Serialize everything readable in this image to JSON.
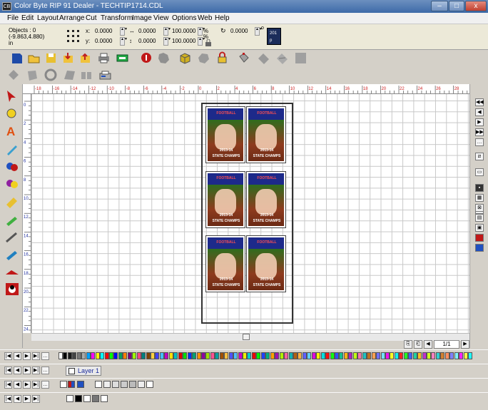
{
  "app": {
    "title": "Color Byte RIP 91 Dealer - TECHTIP1714.CDL",
    "icon_label": "CB"
  },
  "window_controls": {
    "minimize": "–",
    "maximize": "□",
    "close": "x"
  },
  "menu": [
    "File",
    "Edit",
    "Layout",
    "Arrange",
    "Cut",
    "Transform",
    "Image",
    "View",
    "Options",
    "Web",
    "Help"
  ],
  "props": {
    "objects_label": "Objects : 0",
    "coords_readout": "(-9.863,4.880)",
    "units": "in",
    "x_label": "x:",
    "y_label": "y:",
    "x_value": "0.0000",
    "y_value": "0.0000",
    "w_value": "0.0000",
    "h_value": "0.0000",
    "sx_value": "100.0000",
    "sy_value": "100.0000",
    "pct": "%",
    "rotation_value": "0.0000",
    "degree": "o",
    "badge_top": "201",
    "badge_bottom": "p"
  },
  "ruler": {
    "h_labels": [
      "-18",
      "-16",
      "-14",
      "-12",
      "-10",
      "-8",
      "-6",
      "-4",
      "-2",
      "0",
      "2",
      "4",
      "6",
      "8",
      "10",
      "12",
      "14",
      "16",
      "18",
      "20",
      "22",
      "24",
      "26",
      "28"
    ],
    "v_labels": [
      "0",
      "2",
      "4",
      "6",
      "8",
      "10",
      "12",
      "14",
      "16",
      "18",
      "20",
      "22",
      "24"
    ]
  },
  "posters": {
    "line1": "FOOTBALL",
    "line2": "2013-14",
    "line3": "STATE CHAMPS",
    "count": 6
  },
  "pager": {
    "value": "1/1"
  },
  "layer": {
    "name": "Layer 1"
  },
  "colors": {
    "palette": [
      "#ffffff",
      "#000000",
      "#1a1a1a",
      "#444444",
      "#777777",
      "#aaaaaa",
      "#00a0ff",
      "#ff00ff",
      "#ffff00",
      "#00ffff",
      "#ff0000",
      "#00ff00",
      "#0000ff",
      "#00a060",
      "#ff8000",
      "#800080",
      "#a0ff00",
      "#ff4080",
      "#008080",
      "#804000",
      "#ffd040",
      "#4040ff",
      "#40c0ff",
      "#c000c0",
      "#ffe000",
      "#00c0c0",
      "#e00000",
      "#00e000",
      "#0030ff",
      "#00a070",
      "#ff9000",
      "#9000a0",
      "#a0e000",
      "#ff5090",
      "#00a0a0",
      "#a05000",
      "#ffc040",
      "#5050ff",
      "#50c0ff",
      "#d000d0",
      "#f0f000",
      "#00d0d0",
      "#f00000",
      "#00f000",
      "#2040ff",
      "#00b080",
      "#ffa000",
      "#a010b0",
      "#b0f000",
      "#ff60a0",
      "#10b0b0",
      "#b06010",
      "#ffb040",
      "#6060ff",
      "#60d0ff",
      "#e000e0",
      "#fff000",
      "#00e0e0",
      "#ff1010",
      "#10ff10",
      "#3050ff",
      "#10c090",
      "#ffb010",
      "#b020c0",
      "#c0ff10",
      "#ff70b0",
      "#20c0c0",
      "#c07020",
      "#ffa050",
      "#7070ff",
      "#70e0ff",
      "#f010f0",
      "#ffff20",
      "#10f0f0",
      "#ff2020",
      "#20ff20",
      "#4060ff",
      "#20d0a0",
      "#ffc020",
      "#c030d0",
      "#d0ff20",
      "#ff80c0",
      "#30d0d0",
      "#d08030",
      "#ff9060",
      "#8080ff",
      "#80f0ff",
      "#ff20ff",
      "#ffff40",
      "#20ffff",
      "#ff3030",
      "#30ff30"
    ]
  }
}
